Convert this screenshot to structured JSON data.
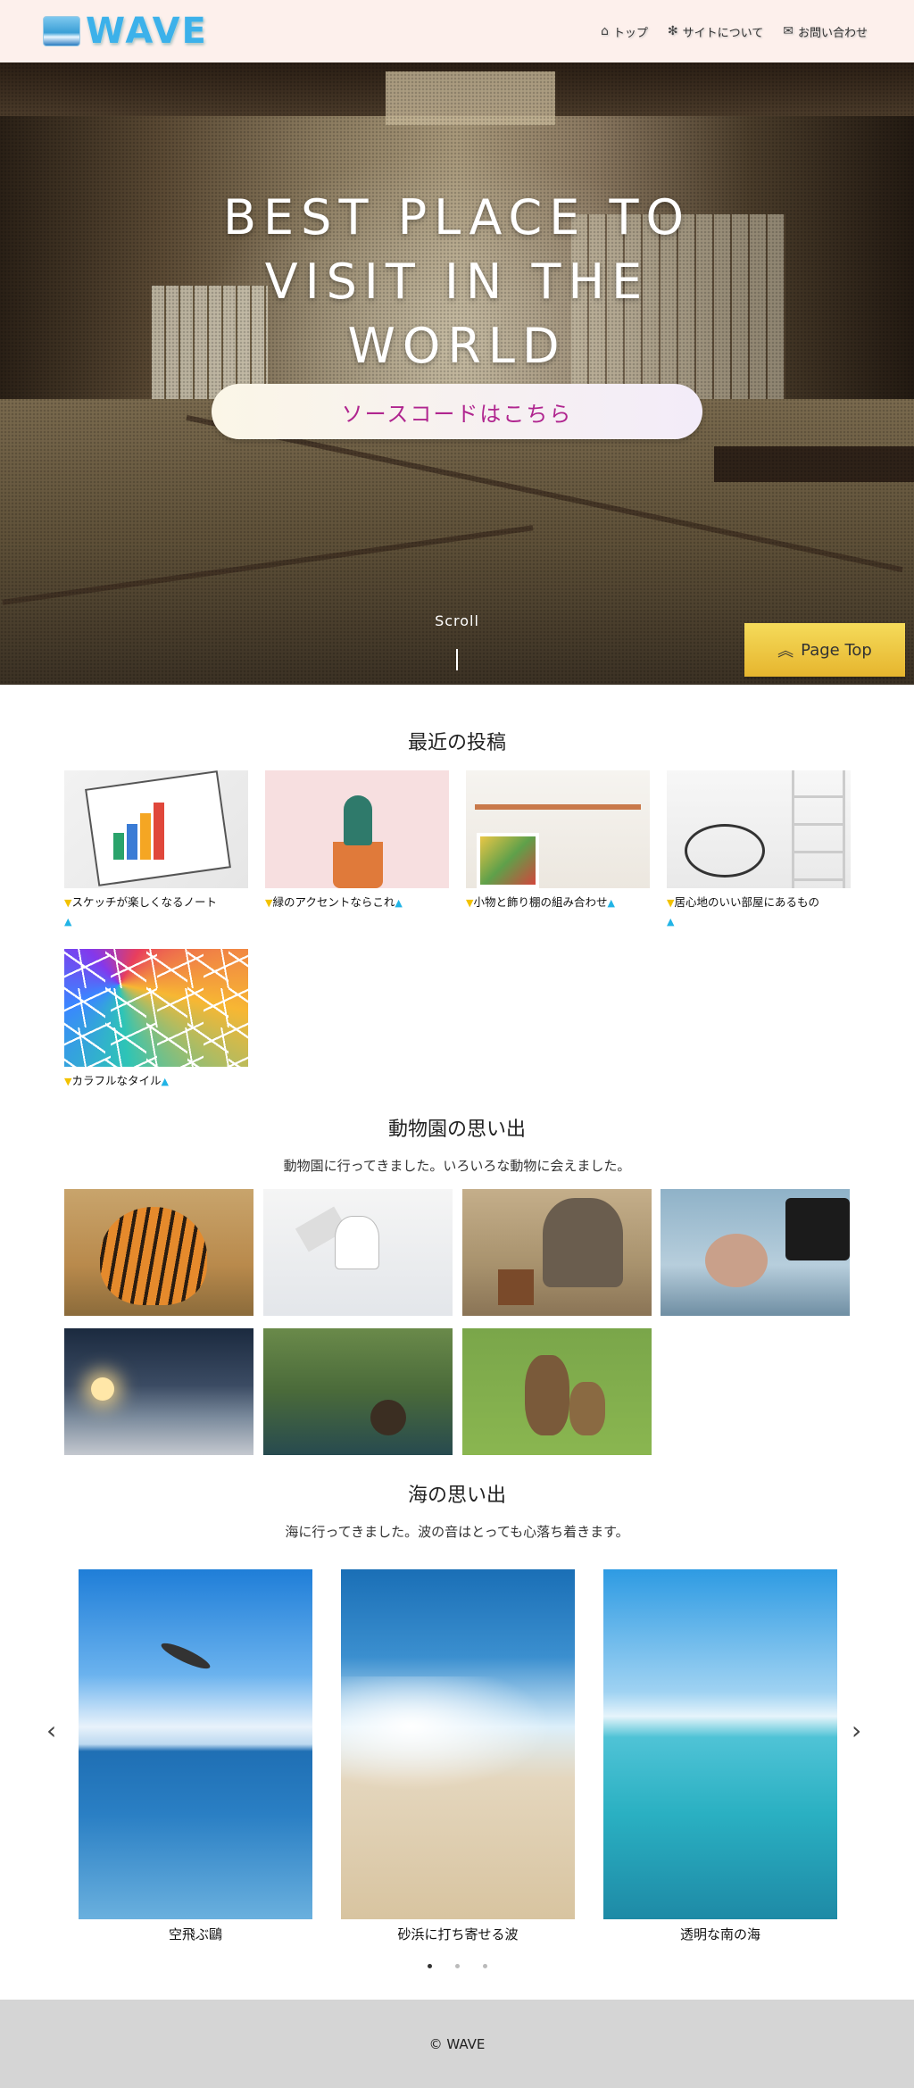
{
  "header": {
    "logo_text": "WAVE",
    "nav": [
      {
        "icon": "home-icon",
        "label": "トップ"
      },
      {
        "icon": "info-icon",
        "label": "サイトについて"
      },
      {
        "icon": "mail-icon",
        "label": "お問い合わせ"
      }
    ]
  },
  "hero": {
    "title_line1": "BEST PLACE TO",
    "title_line2": "VISIT IN THE",
    "title_line3": "WORLD",
    "cta_label": "ソースコードはこちら",
    "scroll_label": "Scroll",
    "page_top_label": "Page Top"
  },
  "recent_posts": {
    "title": "最近の投稿",
    "items": [
      {
        "caption": "スケッチが楽しくなるノート"
      },
      {
        "caption": "緑のアクセントならこれ"
      },
      {
        "caption": "小物と飾り棚の組み合わせ"
      },
      {
        "caption": "居心地のいい部屋にあるもの"
      },
      {
        "caption": "カラフルなタイル"
      }
    ]
  },
  "zoo": {
    "title": "動物園の思い出",
    "subtitle": "動物園に行ってきました。いろいろな動物に会えました。"
  },
  "sea": {
    "title": "海の思い出",
    "subtitle": "海に行ってきました。波の音はとっても心落ち着きます。",
    "slides": [
      {
        "label": "空飛ぶ鷗"
      },
      {
        "label": "砂浜に打ち寄せる波"
      },
      {
        "label": "透明な南の海"
      }
    ]
  },
  "footer": {
    "copyright": "© WAVE"
  },
  "colors": {
    "header_bg": "#fdf0ec",
    "logo": "#3cb1ea",
    "cta_text": "#b0258f",
    "page_top_bg": "#f5db5a",
    "footer_bg": "#d5d5d5"
  }
}
